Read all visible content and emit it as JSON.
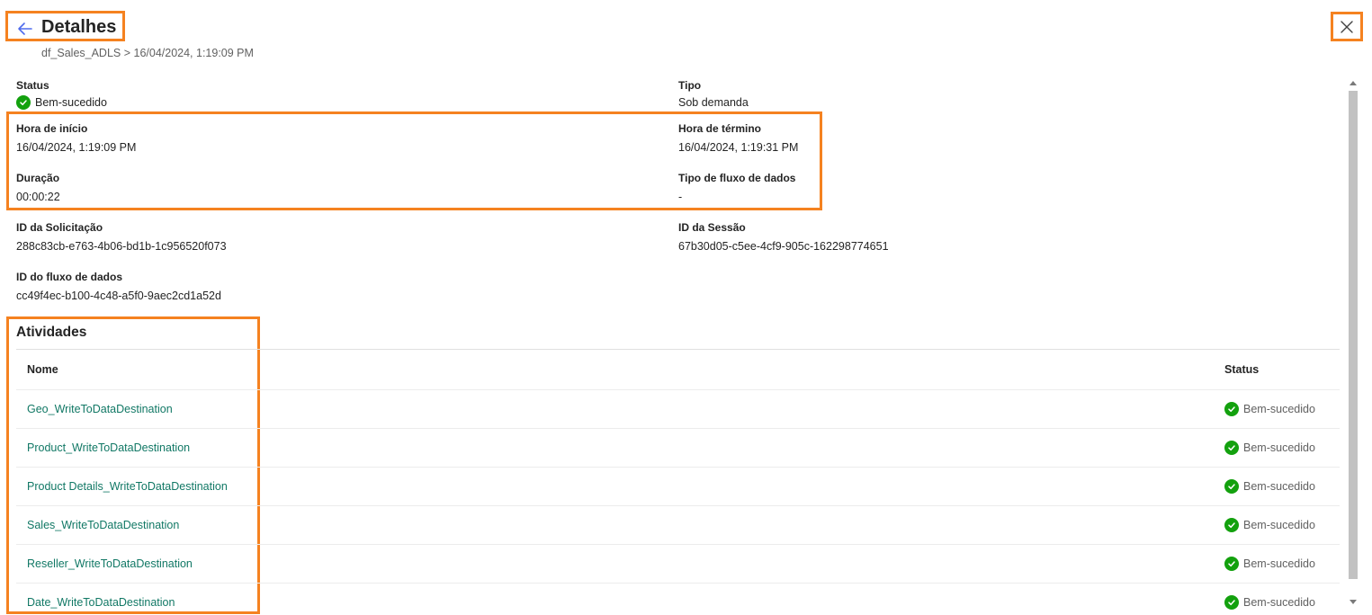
{
  "header": {
    "title": "Detalhes",
    "breadcrumb": "df_Sales_ADLS > 16/04/2024, 1:19:09 PM",
    "back_icon": "arrow-left-icon",
    "close_icon": "close-icon"
  },
  "details": {
    "status": {
      "label": "Status",
      "value": "Bem-sucedido"
    },
    "tipo": {
      "label": "Tipo",
      "value": "Sob demanda"
    },
    "hora_inicio": {
      "label": "Hora de início",
      "value": "16/04/2024, 1:19:09 PM"
    },
    "hora_termino": {
      "label": "Hora de término",
      "value": "16/04/2024, 1:19:31 PM"
    },
    "duracao": {
      "label": "Duração",
      "value": "00:00:22"
    },
    "tipo_fluxo": {
      "label": "Tipo de fluxo de dados",
      "value": "-"
    },
    "id_solicitacao": {
      "label": "ID da Solicitação",
      "value": "288c83cb-e763-4b06-bd1b-1c956520f073"
    },
    "id_sessao": {
      "label": "ID da Sessão",
      "value": "67b30d05-c5ee-4cf9-905c-162298774651"
    },
    "id_fluxo": {
      "label": "ID do fluxo de dados",
      "value": "cc49f4ec-b100-4c48-a5f0-9aec2cd1a52d"
    }
  },
  "activities": {
    "title": "Atividades",
    "columns": {
      "name": "Nome",
      "status": "Status"
    },
    "rows": [
      {
        "name": "Geo_WriteToDataDestination",
        "status": "Bem-sucedido"
      },
      {
        "name": "Product_WriteToDataDestination",
        "status": "Bem-sucedido"
      },
      {
        "name": "Product Details_WriteToDataDestination",
        "status": "Bem-sucedido"
      },
      {
        "name": "Sales_WriteToDataDestination",
        "status": "Bem-sucedido"
      },
      {
        "name": "Reseller_WriteToDataDestination",
        "status": "Bem-sucedido"
      },
      {
        "name": "Date_WriteToDataDestination",
        "status": "Bem-sucedido"
      }
    ]
  },
  "colors": {
    "highlight": "#f58220",
    "success": "#13a10e",
    "link": "#117865"
  }
}
